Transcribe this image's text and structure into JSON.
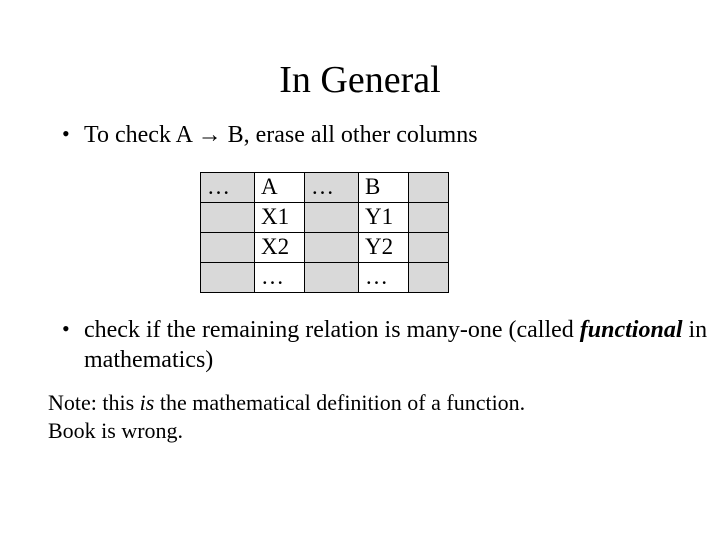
{
  "title": "In General",
  "bullet1": {
    "prefix": "To check  A ",
    "arrow": "→",
    "suffix": " B, erase all other columns"
  },
  "table": {
    "r1": {
      "c1": "…",
      "c2": "A",
      "c3": "…",
      "c4": "B",
      "c5": ""
    },
    "r2": {
      "c1": "",
      "c2": "X1",
      "c3": "",
      "c4": "Y1",
      "c5": ""
    },
    "r3": {
      "c1": "",
      "c2": "X2",
      "c3": "",
      "c4": "Y2",
      "c5": ""
    },
    "r4": {
      "c1": "",
      "c2": "…",
      "c3": "",
      "c4": "…",
      "c5": ""
    }
  },
  "bullet2": {
    "part1": "check if the remaining relation is many-one (called ",
    "emph": "functional",
    "part2": " in mathematics)"
  },
  "note": {
    "line1a": "Note: this ",
    "line1_is": "is ",
    "line1b": " the mathematical definition of a function.",
    "line2": "Book is wrong."
  }
}
